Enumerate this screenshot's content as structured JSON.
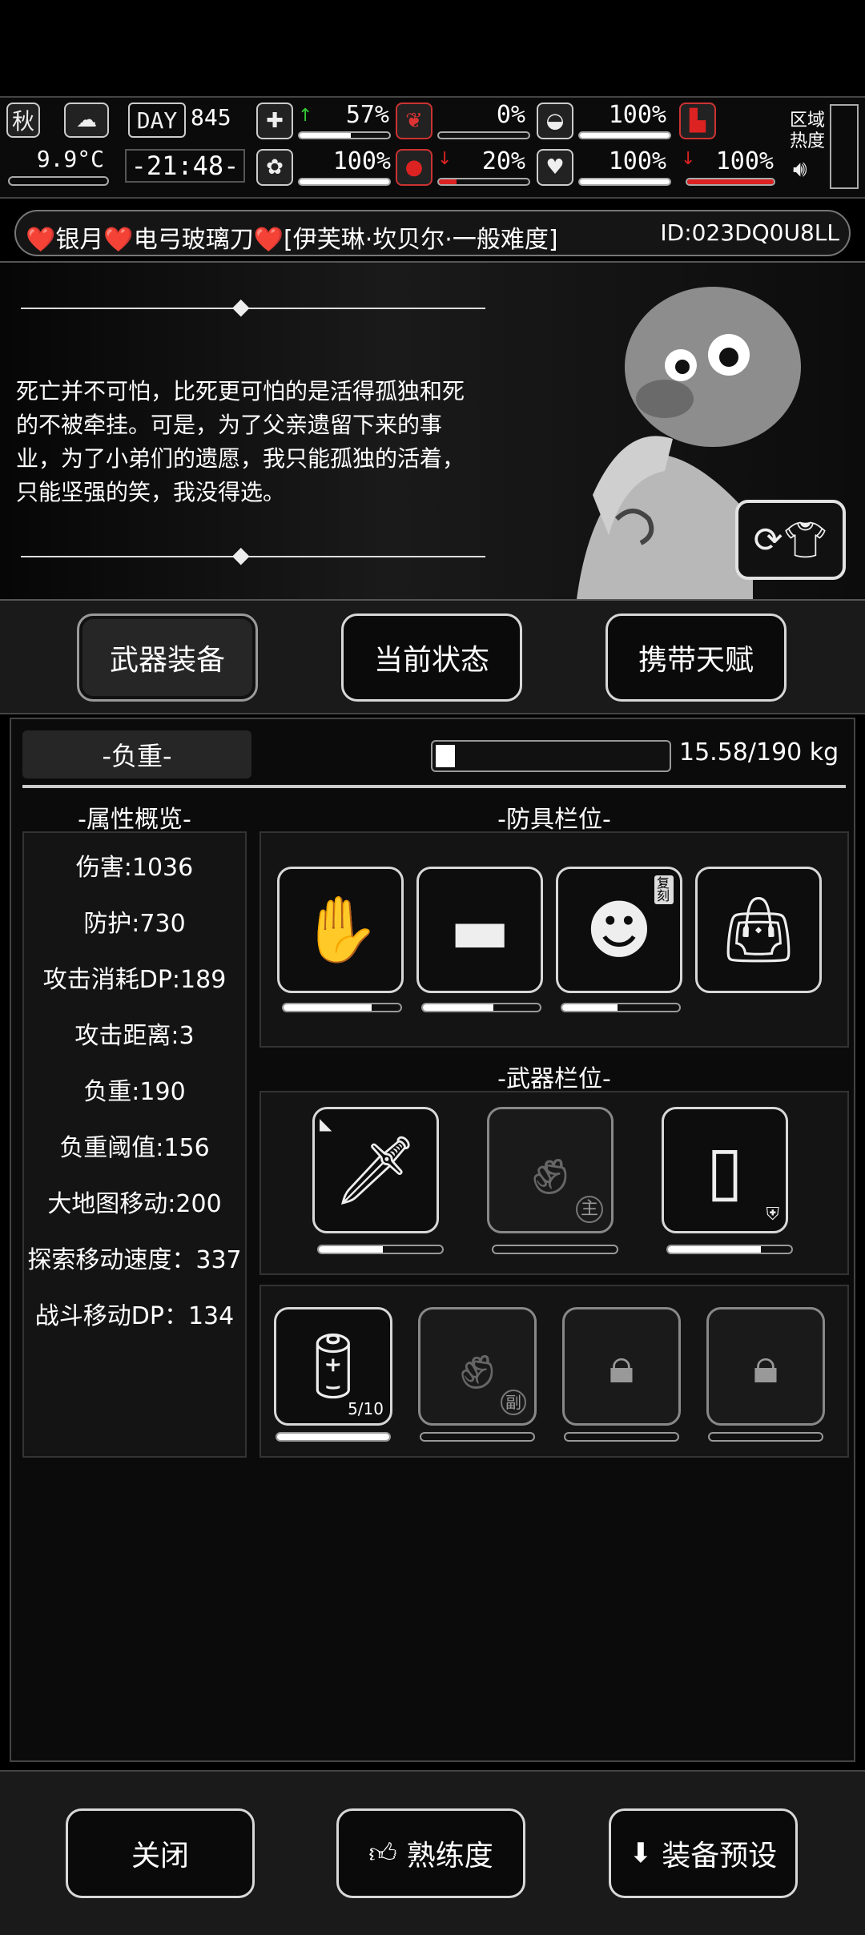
{
  "status": {
    "season": "秋",
    "temperature": "9.9°C",
    "day_label": "DAY",
    "day_number": "845",
    "clock": "-21:48-",
    "zone_label_1": "区域",
    "zone_label_2": "热度",
    "stats": [
      {
        "icon": "medkit-icon",
        "value": "57%",
        "fill": 0.57
      },
      {
        "icon": "stomach-icon",
        "value": "0%",
        "fill": 0
      },
      {
        "icon": "helmet-icon",
        "value": "100%",
        "fill": 1
      },
      {
        "icon": "brain-icon",
        "value": "100%",
        "fill": 1
      },
      {
        "icon": "blood-drop-icon",
        "value": "20%",
        "fill": 0.2
      },
      {
        "icon": "heart-icon",
        "value": "100%",
        "fill": 1
      },
      {
        "icon": "boot-icon",
        "value": "100%",
        "fill": 1
      }
    ]
  },
  "title": {
    "text": "❤️银月❤️电弓玻璃刀❤️[伊芙琳·坎贝尔·一般难度]",
    "id": "ID:023DQ0U8LL"
  },
  "quote": {
    "text": "死亡并不可怕，比死更可怕的是活得孤独和死的不被牵挂。可是，为了父亲遗留下来的事业，为了小弟们的遗愿，我只能孤独的活着，只能坚强的笑，我没得选。"
  },
  "tabs": [
    "武器装备",
    "当前状态",
    "携带天赋"
  ],
  "load": {
    "label": "-负重-",
    "value": "15.58/190 kg",
    "fill": 0.082
  },
  "attributes": {
    "title": "-属性概览-",
    "items": [
      "伤害:1036",
      "防护:730",
      "攻击消耗DP:189",
      "攻击距离:3",
      "负重:190",
      "负重阈值:156",
      "大地图移动:200",
      "探索移动速度：337",
      "战斗移动DP：134"
    ]
  },
  "armor": {
    "title": "-防具栏位-",
    "slots": [
      {
        "icon": "gloves-icon",
        "durability": 0.75
      },
      {
        "icon": "shorts-icon",
        "durability": 0.6
      },
      {
        "icon": "helmet-mask-icon",
        "badge": "复刻",
        "durability": 0.47
      },
      {
        "icon": "bag-icon",
        "durability": null
      }
    ]
  },
  "weapons": {
    "title": "-武器栏位-",
    "main": [
      {
        "icon": "sword-icon",
        "durability": 0.52
      },
      {
        "icon": "fist-icon",
        "badge": "主",
        "durability": 0
      },
      {
        "icon": "gadget-icon",
        "durability": 0.75
      }
    ],
    "secondary": [
      {
        "icon": "battery-icon",
        "count": "5/10",
        "durability": 1
      },
      {
        "icon": "fist-icon",
        "badge": "副",
        "durability": 0
      },
      {
        "icon": "lock-icon",
        "durability": 0
      },
      {
        "icon": "lock-icon",
        "durability": 0
      }
    ]
  },
  "bottom": {
    "close": "关闭",
    "proficiency": "熟练度",
    "preset": "装备预设"
  }
}
